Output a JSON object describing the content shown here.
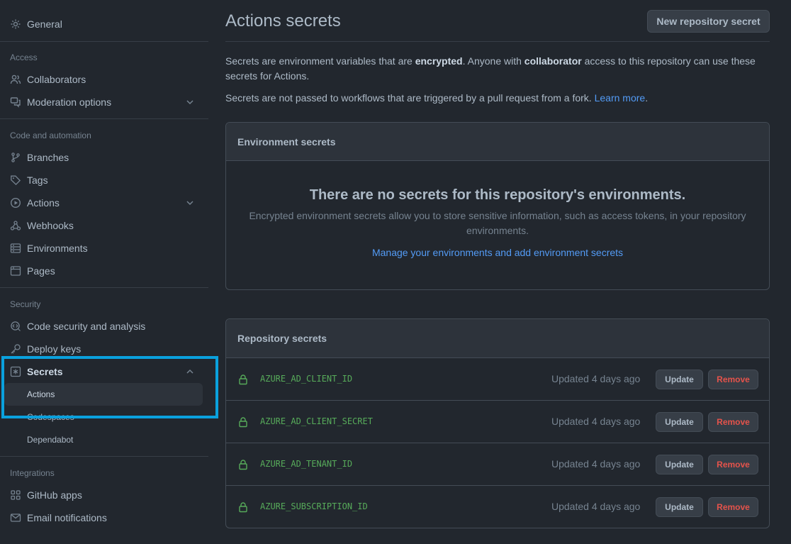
{
  "sidebar": {
    "general": "General",
    "access_heading": "Access",
    "collaborators": "Collaborators",
    "moderation": "Moderation options",
    "code_heading": "Code and automation",
    "branches": "Branches",
    "tags": "Tags",
    "actions": "Actions",
    "webhooks": "Webhooks",
    "environments": "Environments",
    "pages": "Pages",
    "security_heading": "Security",
    "code_security": "Code security and analysis",
    "deploy_keys": "Deploy keys",
    "secrets": "Secrets",
    "secrets_actions": "Actions",
    "secrets_codespaces": "Codespaces",
    "secrets_dependabot": "Dependabot",
    "integrations_heading": "Integrations",
    "github_apps": "GitHub apps",
    "email_notifications": "Email notifications"
  },
  "header": {
    "title": "Actions secrets",
    "new_button": "New repository secret"
  },
  "description": {
    "p1_a": "Secrets are environment variables that are ",
    "p1_b": "encrypted",
    "p1_c": ". Anyone with ",
    "p1_d": "collaborator",
    "p1_e": " access to this repository can use these",
    "p1_f": "secrets for Actions.",
    "p2_a": "Secrets are not passed to workflows that are triggered by a pull request from a fork. ",
    "p2_link": "Learn more",
    "p2_end": "."
  },
  "env_secrets": {
    "header": "Environment secrets",
    "blank_title": "There are no secrets for this repository's environments.",
    "blank_desc_1": "Encrypted environment secrets allow you to store sensitive information, such as access tokens, in your repository",
    "blank_desc_2": "environments.",
    "blank_link": "Manage your environments and add environment secrets"
  },
  "repo_secrets": {
    "header": "Repository secrets",
    "rows": [
      {
        "name": "AZURE_AD_CLIENT_ID",
        "updated": "Updated 4 days ago",
        "update": "Update",
        "remove": "Remove"
      },
      {
        "name": "AZURE_AD_CLIENT_SECRET",
        "updated": "Updated 4 days ago",
        "update": "Update",
        "remove": "Remove"
      },
      {
        "name": "AZURE_AD_TENANT_ID",
        "updated": "Updated 4 days ago",
        "update": "Update",
        "remove": "Remove"
      },
      {
        "name": "AZURE_SUBSCRIPTION_ID",
        "updated": "Updated 4 days ago",
        "update": "Update",
        "remove": "Remove"
      }
    ]
  },
  "colors": {
    "background": "#22272e",
    "link": "#539bf5",
    "secret_name": "#57ab5a",
    "remove": "#e5534b",
    "highlight": "#0aa1dd"
  }
}
